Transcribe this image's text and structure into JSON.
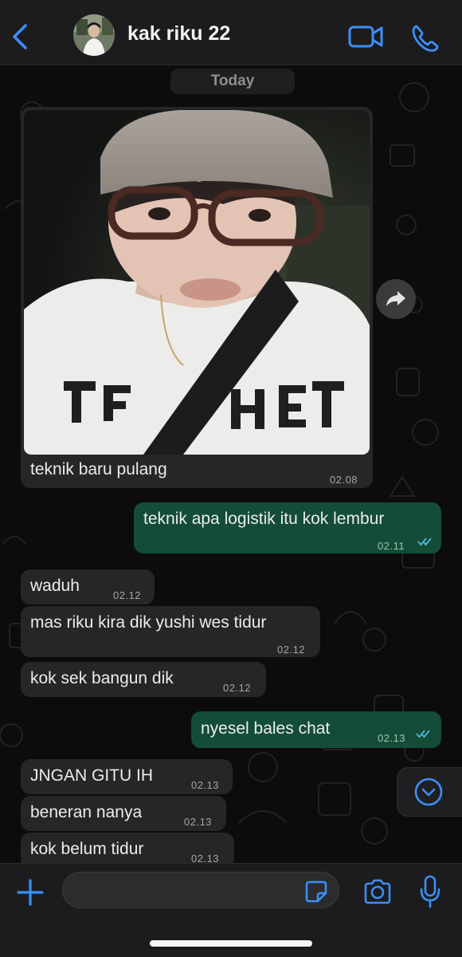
{
  "header": {
    "contact_name": "kak riku 22",
    "icons": {
      "back": "chevron-left-icon",
      "video": "video-camera-icon",
      "call": "phone-icon"
    }
  },
  "chat": {
    "date_divider": "Today",
    "messages": [
      {
        "direction": "in",
        "type": "image",
        "caption": "teknik baru pulang",
        "time": "02.08"
      },
      {
        "direction": "out",
        "text": "teknik apa logistik itu kok lembur",
        "time": "02.11",
        "status": "read"
      },
      {
        "direction": "in",
        "text": "waduh",
        "time": "02.12"
      },
      {
        "direction": "in",
        "text": "mas riku kira dik yushi wes tidur",
        "time": "02.12"
      },
      {
        "direction": "in",
        "text": "kok sek bangun dik",
        "time": "02.12"
      },
      {
        "direction": "out",
        "text": "nyesel bales chat",
        "time": "02.13",
        "status": "read"
      },
      {
        "direction": "in",
        "text": "JNGAN GITU IH",
        "time": "02.13"
      },
      {
        "direction": "in",
        "text": "beneran nanya",
        "time": "02.13"
      },
      {
        "direction": "in",
        "text": "kok belum tidur",
        "time": "02.13"
      }
    ]
  },
  "composer": {
    "message_value": "",
    "icons": {
      "attach": "plus-icon",
      "sticker": "sticker-icon",
      "camera": "camera-icon",
      "mic": "microphone-icon"
    }
  },
  "colors": {
    "accent": "#3d8ef7",
    "outgoing_bubble": "#144d37",
    "incoming_bubble": "#262628",
    "read_ticks": "#53bdeb",
    "header_bg": "#1c1c1e",
    "chat_bg": "#0c0c0c"
  }
}
